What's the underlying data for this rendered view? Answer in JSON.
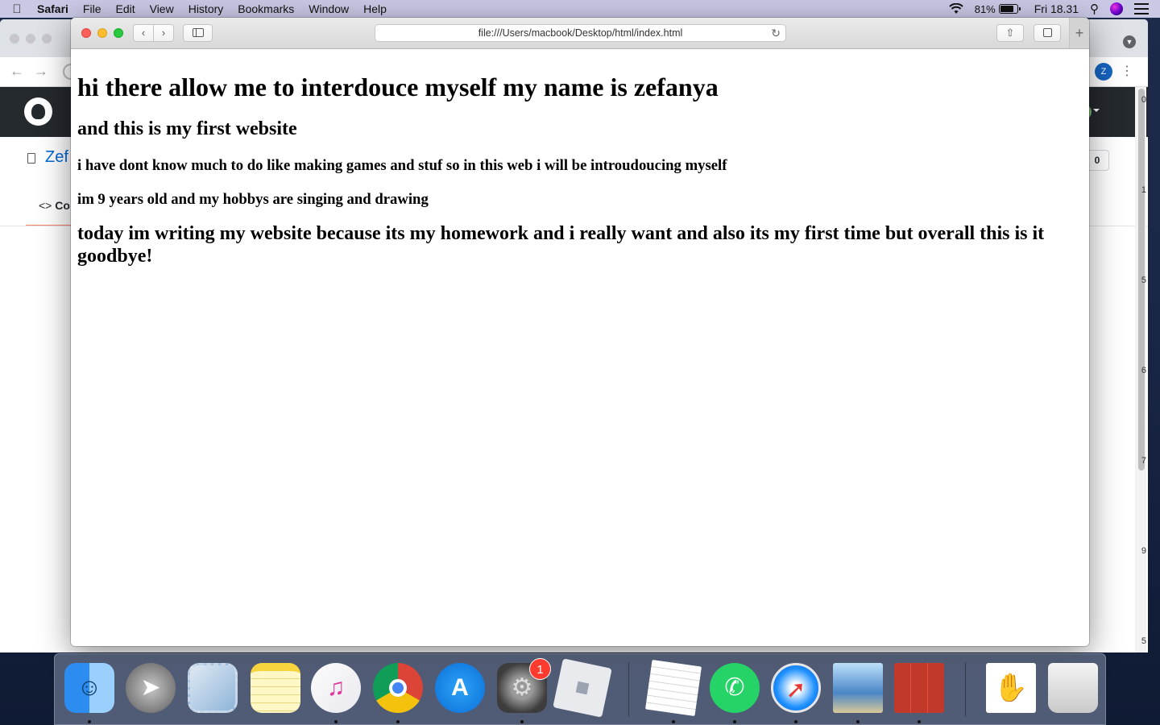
{
  "menubar": {
    "app_name": "Safari",
    "menus": [
      "File",
      "Edit",
      "View",
      "History",
      "Bookmarks",
      "Window",
      "Help"
    ],
    "battery": "81%",
    "battery_level": 0.81,
    "clock": "Fri 18.31"
  },
  "background_window": {
    "repo_name_partial": "Zef",
    "tab_label_partial": "Co",
    "count_badge": "0",
    "avatar_letter": "Z",
    "side_digits": [
      "0",
      "1",
      "5",
      "6",
      "7",
      "9",
      "5"
    ]
  },
  "safari": {
    "url": "file:///Users/macbook/Desktop/html/index.html"
  },
  "page": {
    "h1": "hi there allow me to interdouce myself my name is zefanya",
    "h2_intro": "and this is my first website",
    "h3_games": "i have dont know much to do like making games and stuf so in this web i will be introudoucing myself",
    "h4_age": "im 9 years old and my hobbys are singing and drawing",
    "h2_outro": "today im writing my website because its my homework and i really want and also its my first time but overall this is it goodbye!"
  },
  "dock": {
    "system_prefs_badge": "1",
    "apps": [
      "finder",
      "launchpad",
      "mail",
      "notes",
      "music",
      "chrome",
      "app-store",
      "system-preferences",
      "roblox",
      "textedit",
      "whatsapp",
      "safari",
      "preview",
      "photo-booth",
      "document",
      "trash"
    ]
  }
}
